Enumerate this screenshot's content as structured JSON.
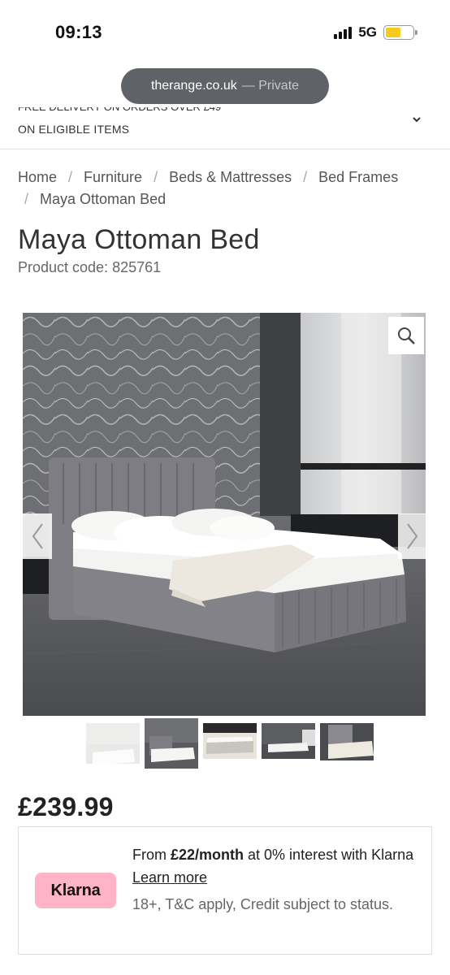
{
  "status_bar": {
    "time": "09:13",
    "network": "5G",
    "battery_level": 0.55
  },
  "browser": {
    "domain": "therange.co.uk",
    "mode": "— Private"
  },
  "banner": {
    "line1": "FREE DELIVERY ON ORDERS OVER £49",
    "line2": "ON ELIGIBLE ITEMS"
  },
  "breadcrumb": {
    "items": [
      "Home",
      "Furniture",
      "Beds & Mattresses",
      "Bed Frames"
    ],
    "separator": "/",
    "current": "Maya Ottoman Bed"
  },
  "product": {
    "title": "Maya Ottoman Bed",
    "code": "Product code: 825761",
    "price": "£239.99"
  },
  "gallery": {
    "thumbnail_count": 5,
    "active_index": 1
  },
  "klarna": {
    "badge": "Klarna",
    "prefix": "From ",
    "amount": "£22/month",
    "suffix": " at 0% interest with Klarna ",
    "link": "Learn more",
    "note": "18+, T&C apply, Credit subject to status."
  },
  "icons": {
    "zoom": "magnifier-icon",
    "prev": "chevron-left-icon",
    "next": "chevron-right-icon",
    "expand": "chevron-down-icon"
  },
  "colors": {
    "klarna_pink": "#ffb3c7",
    "url_pill": "#5f6266",
    "battery": "#f5cc1a"
  }
}
